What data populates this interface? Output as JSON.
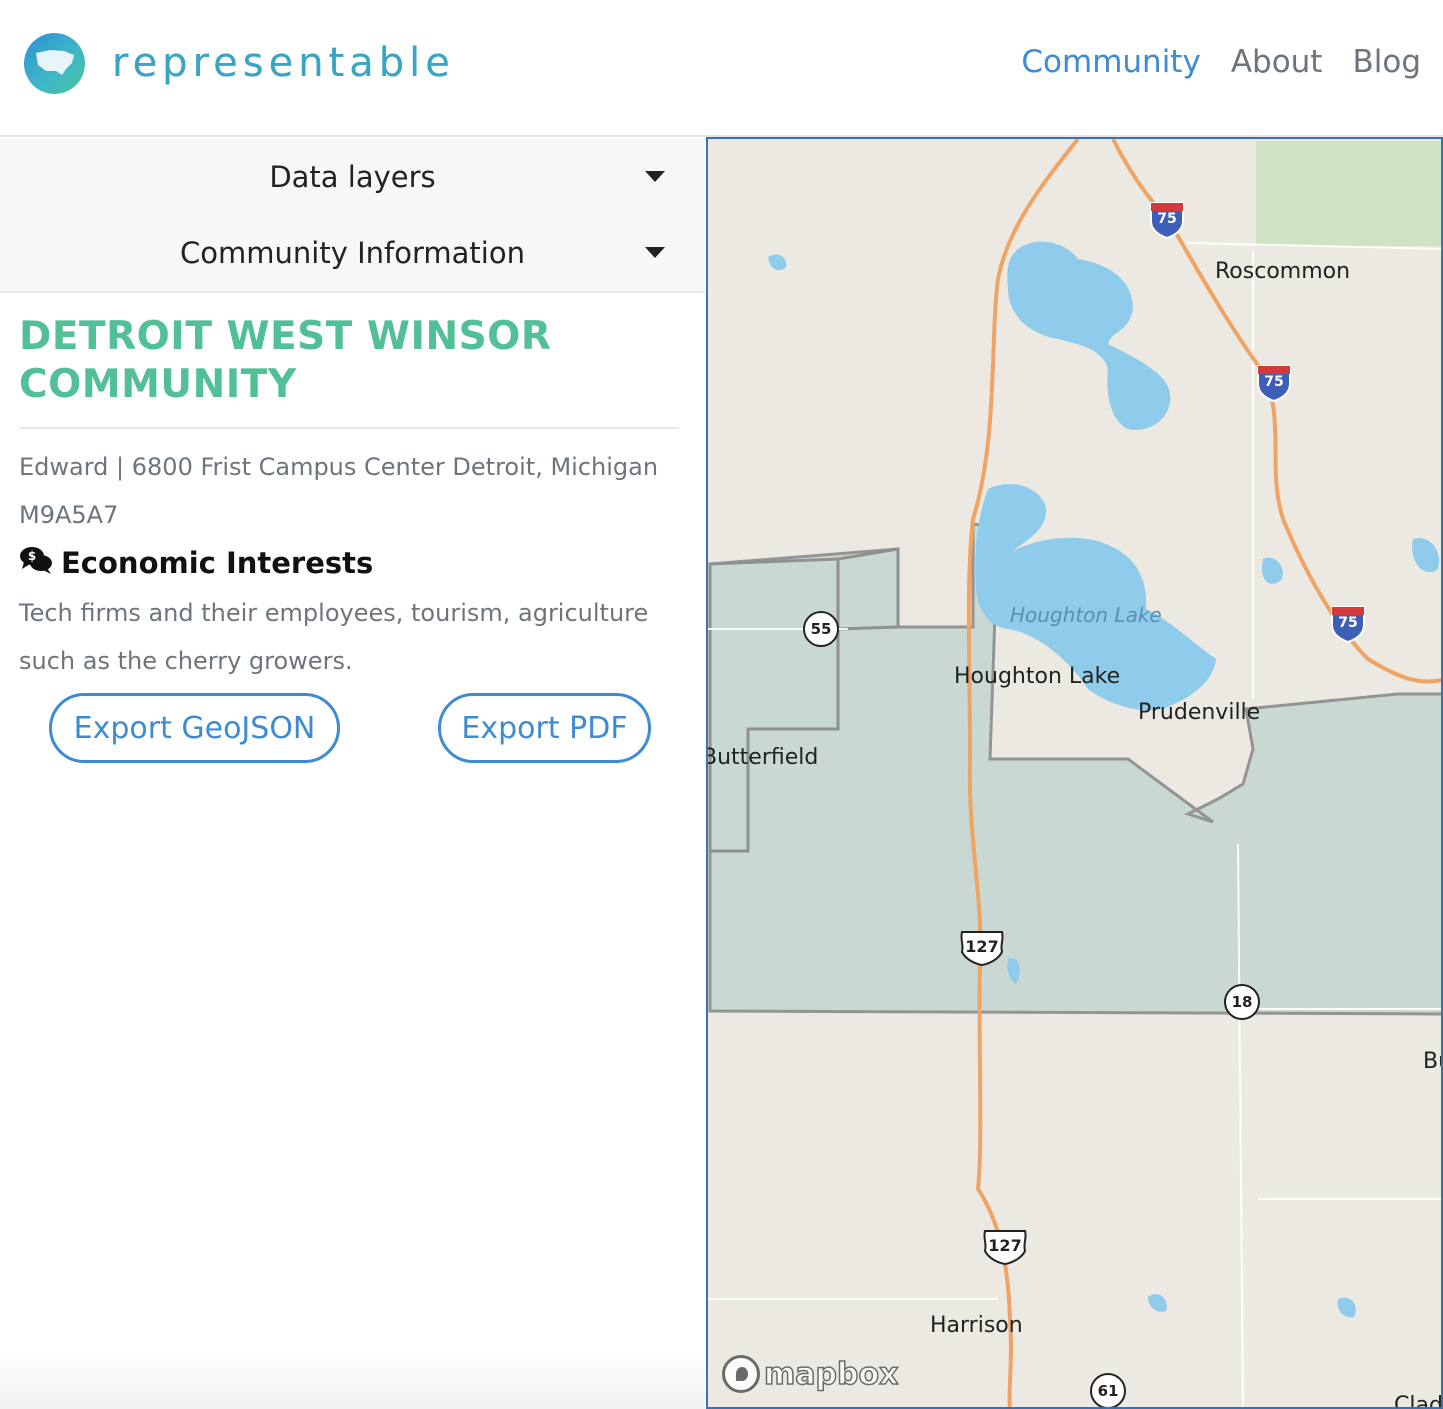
{
  "app": {
    "brand": "representable",
    "nav": [
      {
        "label": "Community",
        "active": true
      },
      {
        "label": "About",
        "active": false
      },
      {
        "label": "Blog",
        "active": false
      }
    ]
  },
  "sidebar": {
    "accordions": [
      {
        "label": "Data layers"
      },
      {
        "label": "Community Information"
      }
    ],
    "community": {
      "title": "DETROIT WEST WINSOR COMMUNITY",
      "author_line": "Edward | 6800 Frist Campus Center Detroit, Michigan M9A5A7",
      "section_icon": "comments-dollar-icon",
      "section_title": "Economic Interests",
      "section_body": "Tech firms and their employees, tourism, agriculture such as the cherry growers."
    },
    "buttons": {
      "export_geojson": "Export GeoJSON",
      "export_pdf": "Export PDF"
    }
  },
  "map": {
    "places": [
      "Roscommon",
      "Houghton Lake",
      "Prudenville",
      "Butterfield",
      "Harrison",
      "Bu",
      "Clad"
    ],
    "lake_label": "Houghton Lake",
    "shields": {
      "interstate": "75",
      "us_route": "127",
      "state_55": "55",
      "state_18": "18",
      "state_61": "61"
    },
    "attribution": "mapbox",
    "colors": {
      "land": "#ece8e2",
      "water": "#8fcbea",
      "highway": "#f0a463",
      "community_fill": "#c8d8d3",
      "boundary": "#909090"
    }
  },
  "colors": {
    "accent": "#3d8bd3",
    "title_green": "#52c096",
    "muted_text": "#6c757d"
  }
}
